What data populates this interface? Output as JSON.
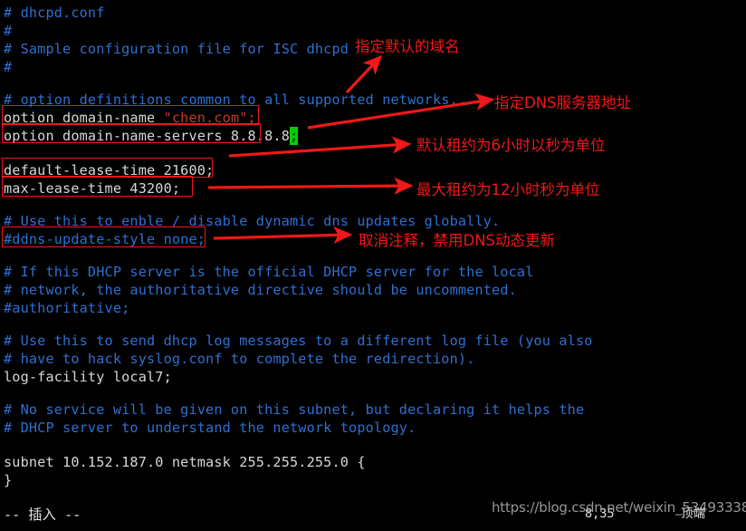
{
  "terminal": {
    "background": "#000000",
    "comment_color": "#2f6fd0",
    "text_color": "#d7d7d7",
    "string_color": "#c03a2b",
    "cursor_color": "#00d000",
    "lines": [
      {
        "id": "l1",
        "text": "# dhcpd.conf",
        "kind": "comment"
      },
      {
        "id": "l2",
        "text": "#",
        "kind": "comment"
      },
      {
        "id": "l3",
        "text": "# Sample configuration file for ISC dhcpd",
        "kind": "comment"
      },
      {
        "id": "l4",
        "text": "#",
        "kind": "comment"
      },
      {
        "id": "l5",
        "text": "",
        "kind": "blank"
      },
      {
        "id": "l6",
        "text": "# option definitions common to all supported networks...",
        "kind": "comment"
      },
      {
        "id": "l7a",
        "text": "option domain-name ",
        "kind": "normal"
      },
      {
        "id": "l7b",
        "text": "\"chen.com\";",
        "kind": "string"
      },
      {
        "id": "l8",
        "text": "option domain-name-servers 8.8.8.8",
        "kind": "normal"
      },
      {
        "id": "l8c",
        "text": ";",
        "kind": "cursor"
      },
      {
        "id": "l9",
        "text": "",
        "kind": "blank"
      },
      {
        "id": "l10",
        "text": "default-lease-time 21600;",
        "kind": "normal"
      },
      {
        "id": "l11",
        "text": "max-lease-time 43200;",
        "kind": "normal"
      },
      {
        "id": "l12",
        "text": "",
        "kind": "blank"
      },
      {
        "id": "l13",
        "text": "# Use this to enble / disable dynamic dns updates globally.",
        "kind": "comment"
      },
      {
        "id": "l14",
        "text": "#ddns-update-style none;",
        "kind": "comment"
      },
      {
        "id": "l15",
        "text": "",
        "kind": "blank"
      },
      {
        "id": "l16",
        "text": "# If this DHCP server is the official DHCP server for the local",
        "kind": "comment"
      },
      {
        "id": "l17",
        "text": "# network, the authoritative directive should be uncommented.",
        "kind": "comment"
      },
      {
        "id": "l18",
        "text": "#authoritative;",
        "kind": "comment"
      },
      {
        "id": "l19",
        "text": "",
        "kind": "blank"
      },
      {
        "id": "l20",
        "text": "# Use this to send dhcp log messages to a different log file (you also",
        "kind": "comment"
      },
      {
        "id": "l21",
        "text": "# have to hack syslog.conf to complete the redirection).",
        "kind": "comment"
      },
      {
        "id": "l22",
        "text": "log-facility local7;",
        "kind": "normal"
      },
      {
        "id": "l23",
        "text": "",
        "kind": "blank"
      },
      {
        "id": "l24",
        "text": "# No service will be given on this subnet, but declaring it helps the",
        "kind": "comment"
      },
      {
        "id": "l25",
        "text": "# DHCP server to understand the network topology.",
        "kind": "comment"
      },
      {
        "id": "l26",
        "text": "",
        "kind": "blank"
      },
      {
        "id": "l27",
        "text": "subnet 10.152.187.0 netmask 255.255.255.0 {",
        "kind": "normal"
      },
      {
        "id": "l28",
        "text": "}",
        "kind": "normal"
      }
    ],
    "status": {
      "mode": "-- 插入 --",
      "cursor_position": "8,35",
      "scroll_position": "顶端"
    }
  },
  "watermark": {
    "text": "https://blog.csdn.net/weixin_53493338"
  },
  "annotations": {
    "accent_color": "#f01818",
    "labels": [
      {
        "id": "a1",
        "text": "指定默认的域名"
      },
      {
        "id": "a2",
        "text": "指定DNS服务器地址"
      },
      {
        "id": "a3",
        "text": "默认租约为6小时以秒为单位"
      },
      {
        "id": "a4",
        "text": "最大租约为12小时秒为单位"
      },
      {
        "id": "a5",
        "text": "取消注释，禁用DNS动态更新"
      }
    ],
    "boxes": [
      {
        "id": "b1",
        "target": "option domain-name \"chen.com\";"
      },
      {
        "id": "b2",
        "target": "option domain-name-servers 8.8.8.8;"
      },
      {
        "id": "b3",
        "target": "default-lease-time 21600;"
      },
      {
        "id": "b4",
        "target": "max-lease-time 43200;"
      },
      {
        "id": "b5",
        "target": "#ddns-update-style none;"
      }
    ]
  }
}
